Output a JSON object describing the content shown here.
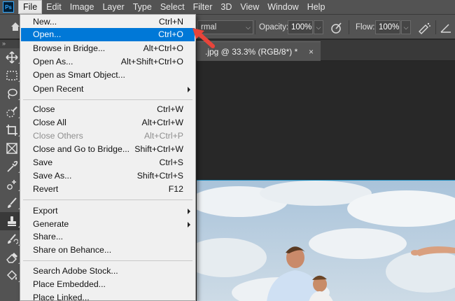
{
  "menubar": {
    "logo": "Ps",
    "items": [
      "File",
      "Edit",
      "Image",
      "Layer",
      "Type",
      "Select",
      "Filter",
      "3D",
      "View",
      "Window",
      "Help"
    ],
    "active": "File"
  },
  "options": {
    "mode_value": "rmal",
    "opacity_label": "Opacity:",
    "opacity_value": "100%",
    "flow_label": "Flow:",
    "flow_value": "100%"
  },
  "document": {
    "tab_title": ".jpg @ 33.3% (RGB/8*) *",
    "close": "×"
  },
  "toolbar": {
    "collapse": "»",
    "tools": [
      "move-tool",
      "marquee-tool",
      "lasso-tool",
      "quick-selection-tool",
      "crop-tool",
      "frame-tool",
      "eyedropper-tool",
      "healing-brush-tool",
      "brush-tool",
      "clone-stamp-tool",
      "history-brush-tool",
      "eraser-tool",
      "paint-bucket-tool"
    ]
  },
  "file_menu": {
    "items": [
      {
        "label": "New...",
        "shortcut": "Ctrl+N"
      },
      {
        "label": "Open...",
        "shortcut": "Ctrl+O",
        "highlighted": true
      },
      {
        "label": "Browse in Bridge...",
        "shortcut": "Alt+Ctrl+O"
      },
      {
        "label": "Open As...",
        "shortcut": "Alt+Shift+Ctrl+O"
      },
      {
        "label": "Open as Smart Object...",
        "shortcut": ""
      },
      {
        "label": "Open Recent",
        "shortcut": "",
        "submenu": true
      },
      {
        "label": "Close",
        "shortcut": "Ctrl+W"
      },
      {
        "label": "Close All",
        "shortcut": "Alt+Ctrl+W"
      },
      {
        "label": "Close Others",
        "shortcut": "Alt+Ctrl+P",
        "disabled": true
      },
      {
        "label": "Close and Go to Bridge...",
        "shortcut": "Shift+Ctrl+W"
      },
      {
        "label": "Save",
        "shortcut": "Ctrl+S"
      },
      {
        "label": "Save As...",
        "shortcut": "Shift+Ctrl+S"
      },
      {
        "label": "Revert",
        "shortcut": "F12"
      },
      {
        "label": "Export",
        "shortcut": "",
        "submenu": true
      },
      {
        "label": "Generate",
        "shortcut": "",
        "submenu": true
      },
      {
        "label": "Share...",
        "shortcut": ""
      },
      {
        "label": "Share on Behance...",
        "shortcut": ""
      },
      {
        "label": "Search Adobe Stock...",
        "shortcut": ""
      },
      {
        "label": "Place Embedded...",
        "shortcut": ""
      },
      {
        "label": "Place Linked...",
        "shortcut": ""
      }
    ]
  },
  "colors": {
    "highlight": "#0078d7",
    "annotation_arrow": "#e8443a",
    "menubar_bg": "#535353",
    "menu_bg": "#f0f0f0"
  }
}
